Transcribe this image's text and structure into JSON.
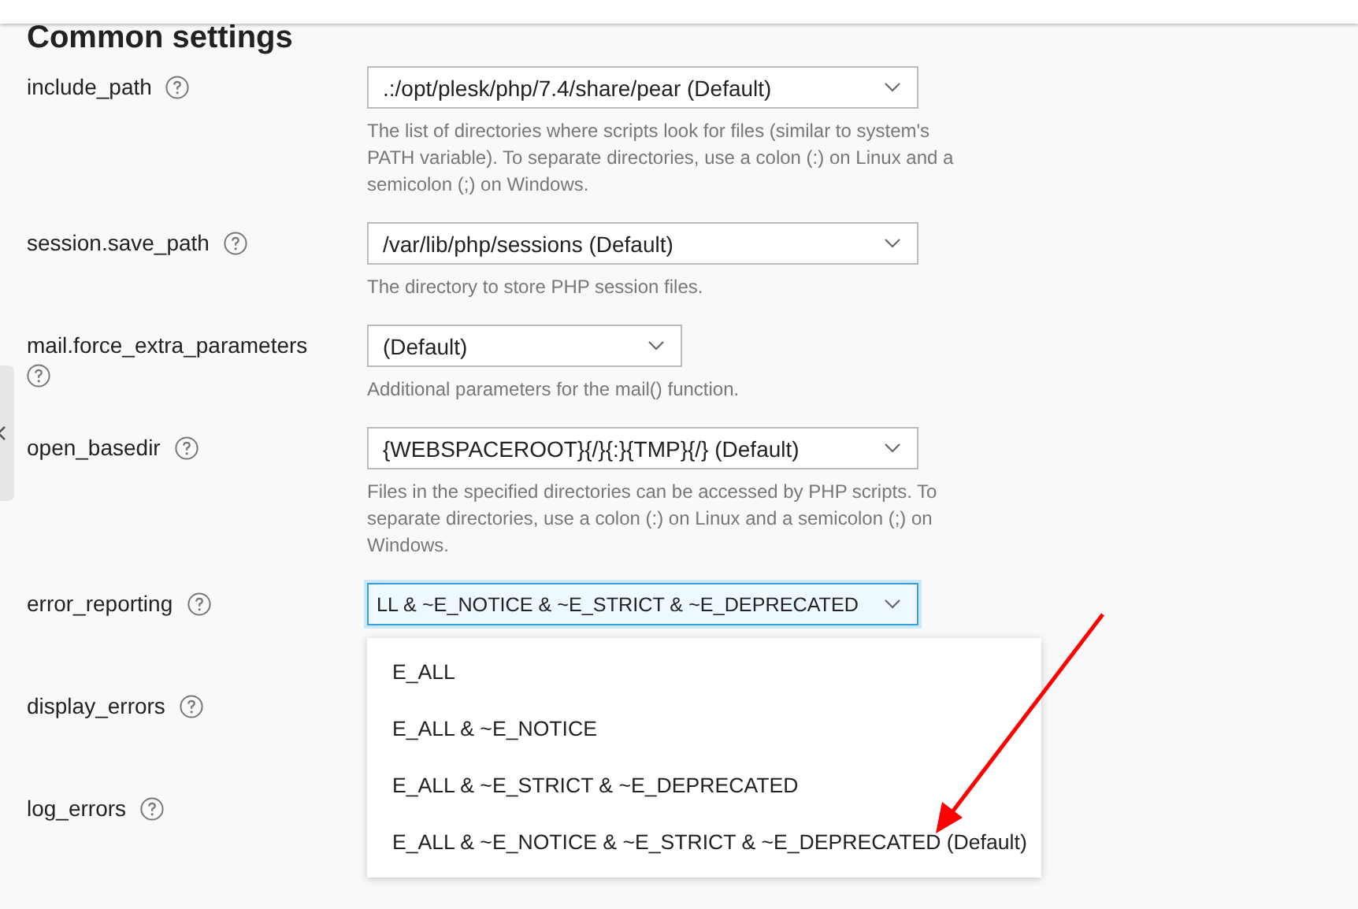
{
  "section_title": "Common settings",
  "settings": [
    {
      "label": "include_path",
      "value": ".:/opt/plesk/php/7.4/share/pear (Default)",
      "focused": false,
      "description": "The list of directories where scripts look for files (similar to system's PATH variable). To separate directories, use a colon (:) on Linux and a semicolon (;) on Windows."
    },
    {
      "label": "session.save_path",
      "value": "/var/lib/php/sessions (Default)",
      "focused": false,
      "description": "The directory to store PHP session files."
    },
    {
      "label": "mail.force_extra_parameters",
      "value": "(Default)",
      "focused": false,
      "description": "Additional parameters for the mail() function."
    },
    {
      "label": "open_basedir",
      "value": "{WEBSPACEROOT}{/}{:}{TMP}{/} (Default)",
      "focused": false,
      "description": "Files in the specified directories can be accessed by PHP scripts. To separate directories, use a colon (:) on Linux and a semicolon (;) on Windows."
    },
    {
      "label": "error_reporting",
      "value": "LL & ~E_NOTICE & ~E_STRICT & ~E_DEPRECATED",
      "focused": true,
      "options": [
        "E_ALL",
        "E_ALL & ~E_NOTICE",
        "E_ALL & ~E_STRICT & ~E_DEPRECATED",
        "E_ALL & ~E_NOTICE & ~E_STRICT & ~E_DEPRECATED (Default)"
      ]
    },
    {
      "label": "display_errors"
    },
    {
      "label": "log_errors"
    }
  ]
}
